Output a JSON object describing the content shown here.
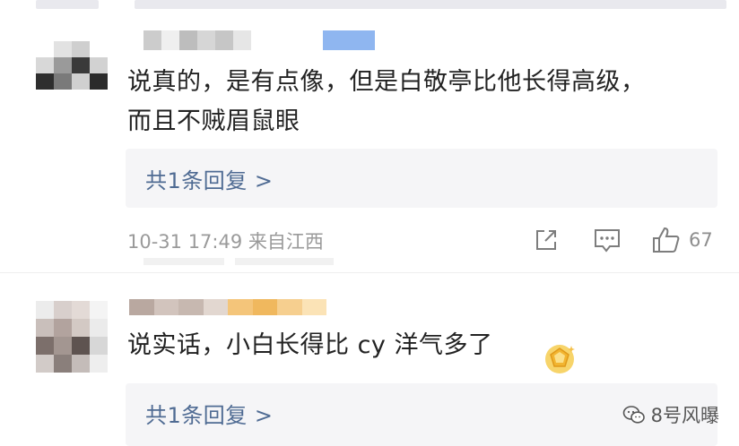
{
  "comments": [
    {
      "text_line1": "说真的，是有点像，但是白敬亭比他长得高级，",
      "text_line2": "而且不贼眉鼠眼",
      "reply_label": "共1条回复 >",
      "meta": "10-31 17:49  来自江西",
      "like_count": "67"
    },
    {
      "text": "说实话，小白长得比 cy 洋气多了",
      "reply_label": "共1条回复 >"
    }
  ],
  "watermark": {
    "label": "8号风曝"
  },
  "icons": {
    "share": "share-icon",
    "comment": "comment-icon",
    "like": "thumbs-up-icon",
    "badge": "gold-badge-icon",
    "wechat": "wechat-icon"
  },
  "colors": {
    "link": "#4f6b93",
    "meta": "#9a9a9a",
    "reply_bg": "#f5f5f7"
  }
}
